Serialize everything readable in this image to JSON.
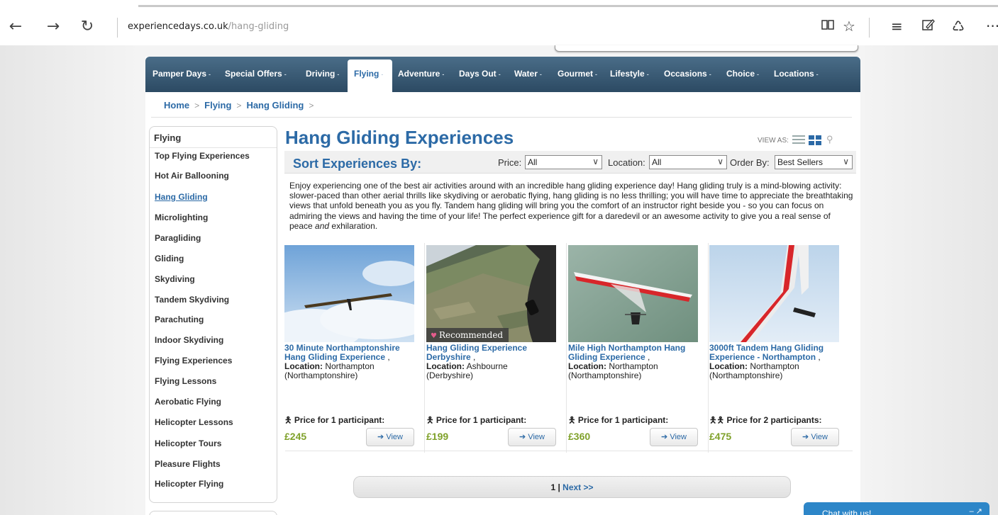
{
  "browser": {
    "url_domain": "experiencedays.co.uk",
    "url_path": "/hang-gliding",
    "icons": [
      "back-arrow-icon",
      "forward-arrow-icon",
      "refresh-icon",
      "reading-view-icon",
      "favorite-star-icon",
      "hub-icon",
      "web-note-icon",
      "share-icon",
      "more-icon"
    ]
  },
  "nav": {
    "items": [
      "Pamper Days",
      "Special Offers",
      "Driving",
      "Flying",
      "Adventure",
      "Days Out",
      "Water",
      "Gourmet",
      "Lifestyle",
      "Occasions",
      "Choice",
      "Locations"
    ],
    "caret": "-",
    "active": "Flying"
  },
  "breadcrumb": [
    "Home",
    "Flying",
    "Hang Gliding"
  ],
  "breadcrumb_sep": ">",
  "sidebar": {
    "heading": "Flying",
    "items": [
      "Top Flying Experiences",
      "Hot Air Ballooning",
      "Hang Gliding",
      "Microlighting",
      "Paragliding",
      "Gliding",
      "Skydiving",
      "Tandem Skydiving",
      "Parachuting",
      "Indoor Skydiving",
      "Flying Experiences",
      "Flying Lessons",
      "Aerobatic Flying",
      "Helicopter Lessons",
      "Helicopter Tours",
      "Pleasure Flights",
      "Helicopter Flying"
    ],
    "current": "Hang Gliding"
  },
  "main": {
    "title": "Hang Gliding Experiences",
    "view_as": "VIEW AS:",
    "sort_label": "Sort Experiences By:",
    "filters": {
      "price_label": "Price:",
      "price_value": "All",
      "location_label": "Location:",
      "location_value": "All",
      "order_label": "Order By:",
      "order_value": "Best Sellers"
    },
    "description_before": "Enjoy experiencing one of the best air activities around with an incredible hang gliding experience day! Hang gliding truly is a mind-blowing activity: slower-paced than other aerial thrills like skydiving or aerobatic flying, hang gliding is no less thrilling; you will have time to appreciate the breathtaking views that unfold beneath you as you fly. Tandem hang gliding will bring you the comfort of an instructor right beside you - so you can focus on admiring the views and having the time of your life! The perfect experience gift for a daredevil or an awesome activity to give you a real sense of peace ",
    "description_em": "and",
    "description_after": " exhilaration."
  },
  "products": [
    {
      "title": "30 Minute Northamptonshire Hang Gliding Experience",
      "comma": " ,",
      "location_label": "Location:",
      "location": "Northampton (Northamptonshire)",
      "price_label": "Price for 1 participant:",
      "price": "£245",
      "view": "View",
      "badge": "",
      "people_icon": "person-icon"
    },
    {
      "title": "Hang Gliding Experience Derbyshire",
      "comma": " ,",
      "location_label": "Location:",
      "location": "Ashbourne (Derbyshire)",
      "price_label": "Price for 1 participant:",
      "price": "£199",
      "view": "View",
      "badge": "Recommended",
      "people_icon": "person-icon"
    },
    {
      "title": "Mile High Northampton Hang Gliding Experience",
      "comma": " ,",
      "location_label": "Location:",
      "location": "Northampton (Northamptonshire)",
      "price_label": "Price for 1 participant:",
      "price": "£360",
      "view": "View",
      "badge": "",
      "people_icon": "person-icon"
    },
    {
      "title": "3000ft Tandem Hang Gliding Experience - Northampton",
      "comma": " ,",
      "location_label": "Location:",
      "location": "Northampton (Northamptonshire)",
      "price_label": "Price for 2 participants:",
      "price": "£475",
      "view": "View",
      "badge": "",
      "people_icon": "two-people-icon"
    }
  ],
  "pagination": {
    "current": "1",
    "sep": " | ",
    "next": "Next >>"
  },
  "chat": {
    "label": "Chat with us!"
  }
}
